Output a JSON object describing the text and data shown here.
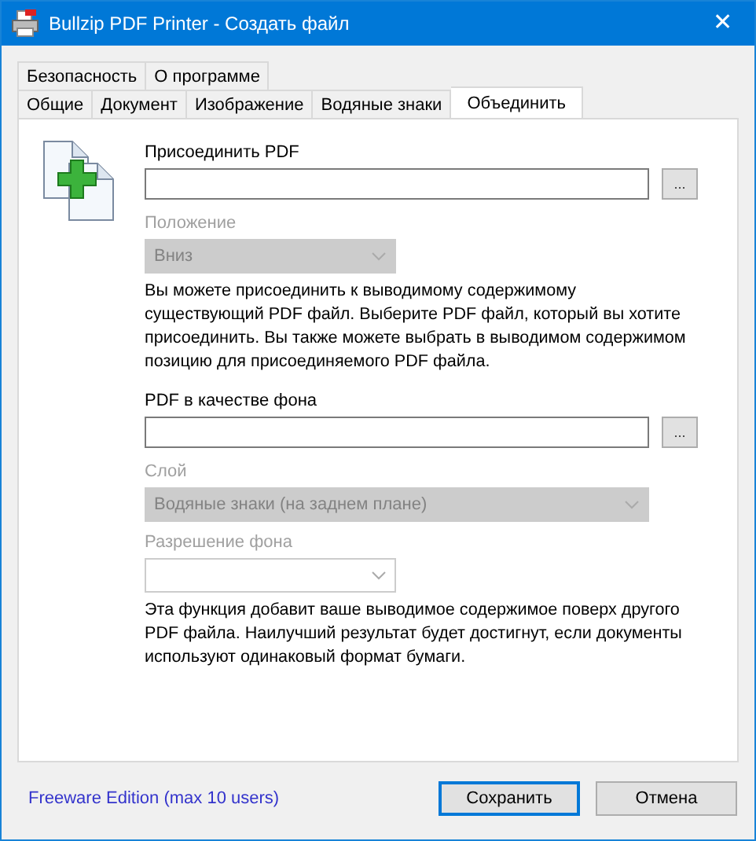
{
  "window": {
    "title": "Bullzip PDF Printer - Создать файл",
    "close": "✕"
  },
  "tab_rows": [
    [
      {
        "label": "Безопасность",
        "selected": false
      },
      {
        "label": "О программе",
        "selected": false
      }
    ],
    [
      {
        "label": "Общие",
        "selected": false
      },
      {
        "label": "Документ",
        "selected": false
      },
      {
        "label": "Изображение",
        "selected": false
      },
      {
        "label": "Водяные знаки",
        "selected": false
      },
      {
        "label": "Объединить",
        "selected": true
      }
    ]
  ],
  "form": [
    {
      "kind": "label",
      "text": "Присоединить PDF",
      "disabled": false
    },
    {
      "kind": "file",
      "browse": "..."
    },
    {
      "kind": "label",
      "text": "Положение",
      "disabled": true
    },
    {
      "kind": "select",
      "value": "Вниз",
      "disabled": true
    },
    {
      "kind": "note",
      "text": "Вы можете присоединить к выводимому содержимому существующий PDF файл. Выберите PDF файл, который вы хотите присоединить. Вы также можете выбрать в выводимом содержимом позицию для присоединяемого PDF файла."
    },
    {
      "kind": "gap"
    },
    {
      "kind": "label",
      "text": "PDF в качестве фона",
      "disabled": false
    },
    {
      "kind": "file",
      "browse": "..."
    },
    {
      "kind": "label",
      "text": "Слой",
      "disabled": true
    },
    {
      "kind": "select-wide",
      "value": "Водяные знаки (на заднем плане)",
      "disabled": true
    },
    {
      "kind": "label",
      "text": "Разрешение фона",
      "disabled": true
    },
    {
      "kind": "select",
      "disabled": true
    },
    {
      "kind": "note",
      "text": "Эта функция добавит ваше выводимое содержимое поверх другого PDF файла. Наилучший результат будет достигнут, если документы используют одинаковый формат бумаги."
    }
  ],
  "footer": {
    "link": "Freeware Edition (max 10 users)",
    "buttons": [
      {
        "label": "Сохранить",
        "default": true
      },
      {
        "label": "Отмена",
        "default": false
      }
    ]
  }
}
